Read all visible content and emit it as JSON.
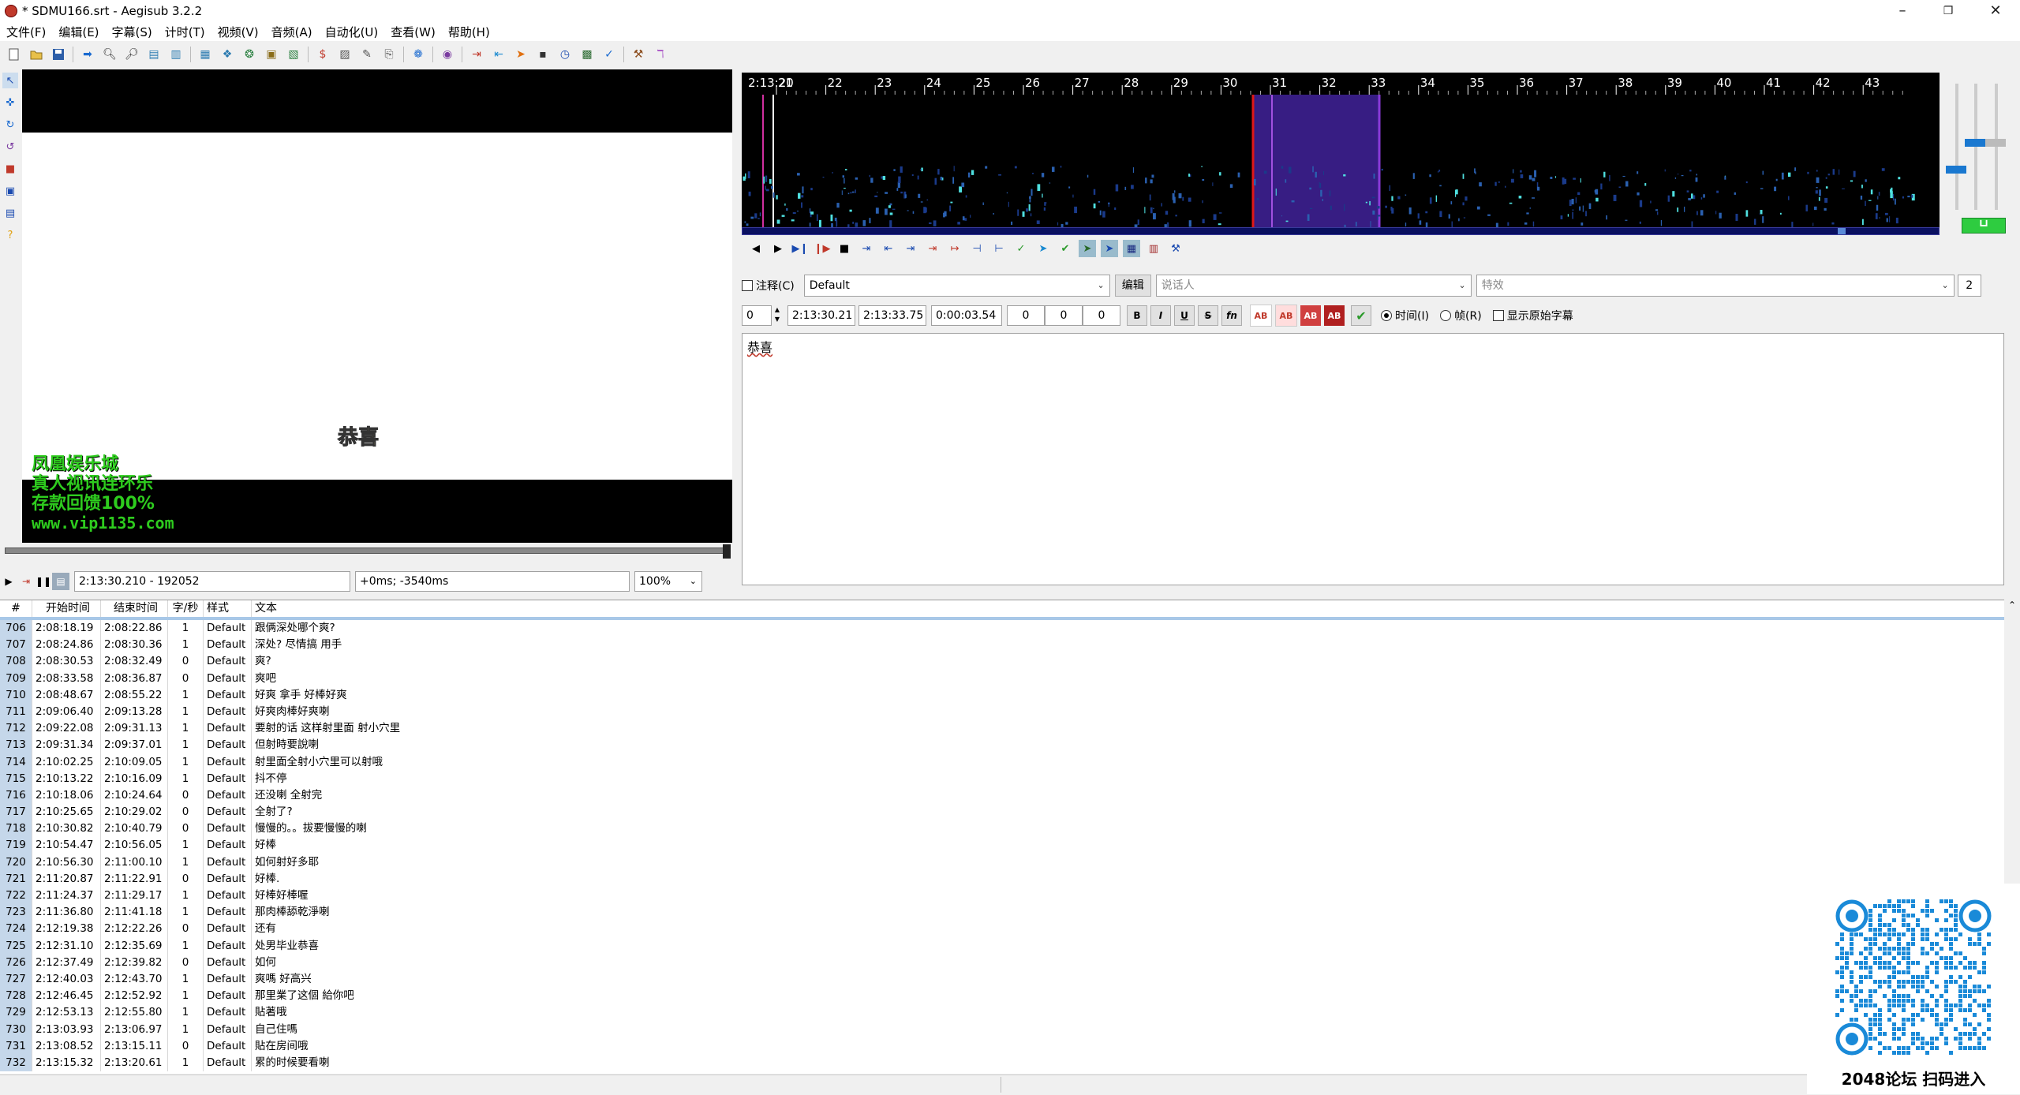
{
  "window": {
    "title": "* SDMU166.srt - Aegisub 3.2.2"
  },
  "menu": [
    "文件(F)",
    "编辑(E)",
    "字幕(S)",
    "计时(T)",
    "视频(V)",
    "音频(A)",
    "自动化(U)",
    "查看(W)",
    "帮助(H)"
  ],
  "video": {
    "ad_lines": [
      "凤凰娱乐城",
      "真人视讯连环乐",
      "存款回馈100%",
      "www.vip1135.com"
    ],
    "subtitle_center": "恭喜",
    "subtitle_right": "恭喜",
    "time_field": "2:13:30.210 - 192052",
    "offset_field": "+0ms; -3540ms",
    "zoom": "100%"
  },
  "audio": {
    "start_label": "2:13:20",
    "tick_labels": [
      "21",
      "22",
      "23",
      "24",
      "25",
      "26",
      "27",
      "28",
      "29",
      "30",
      "31",
      "32",
      "33",
      "34",
      "35",
      "36",
      "37",
      "38",
      "39",
      "40",
      "41",
      "42",
      "43"
    ],
    "selection_color": "#3a1f8a",
    "start_marker_color": "#e01818",
    "end_marker_color": "#8a3ad8"
  },
  "edit": {
    "comment_label": "注释(C)",
    "style_value": "Default",
    "edit_button": "编辑",
    "actor_placeholder": "说话人",
    "effect_placeholder": "特效",
    "char_count": "2",
    "layer": "0",
    "start_time": "2:13:30.21",
    "end_time": "2:13:33.75",
    "duration": "0:00:03.54",
    "margin_l": "0",
    "margin_r": "0",
    "margin_v": "0",
    "fmt_bold": "B",
    "fmt_italic": "I",
    "fmt_underline": "U",
    "fmt_strike": "S",
    "fmt_font": "fn",
    "color_label": "AB",
    "radio_time": "时间(I)",
    "radio_frame": "帧(R)",
    "show_original": "显示原始字幕",
    "text": "恭喜"
  },
  "grid": {
    "headers": {
      "num": "#",
      "start": "开始时间",
      "end": "结束时间",
      "cps": "字/秒",
      "style": "样式",
      "text": "文本"
    },
    "rows": [
      {
        "n": "706",
        "s": "2:08:18.19",
        "e": "2:08:22.86",
        "c": "1",
        "st": "Default",
        "t": "跟俩深处哪个爽?"
      },
      {
        "n": "707",
        "s": "2:08:24.86",
        "e": "2:08:30.36",
        "c": "1",
        "st": "Default",
        "t": "深处? 尽情搞 用手"
      },
      {
        "n": "708",
        "s": "2:08:30.53",
        "e": "2:08:32.49",
        "c": "0",
        "st": "Default",
        "t": "爽?"
      },
      {
        "n": "709",
        "s": "2:08:33.58",
        "e": "2:08:36.87",
        "c": "0",
        "st": "Default",
        "t": "爽吧"
      },
      {
        "n": "710",
        "s": "2:08:48.67",
        "e": "2:08:55.22",
        "c": "1",
        "st": "Default",
        "t": "好爽 拿手 好棒好爽"
      },
      {
        "n": "711",
        "s": "2:09:06.40",
        "e": "2:09:13.28",
        "c": "1",
        "st": "Default",
        "t": "好爽肉棒好爽喇"
      },
      {
        "n": "712",
        "s": "2:09:22.08",
        "e": "2:09:31.13",
        "c": "1",
        "st": "Default",
        "t": "要射的话 这样射里面 射小穴里"
      },
      {
        "n": "713",
        "s": "2:09:31.34",
        "e": "2:09:37.01",
        "c": "1",
        "st": "Default",
        "t": "但射時要說喇"
      },
      {
        "n": "714",
        "s": "2:10:02.25",
        "e": "2:10:09.05",
        "c": "1",
        "st": "Default",
        "t": "射里面全射小穴里可以射哦"
      },
      {
        "n": "715",
        "s": "2:10:13.22",
        "e": "2:10:16.09",
        "c": "1",
        "st": "Default",
        "t": "抖不停"
      },
      {
        "n": "716",
        "s": "2:10:18.06",
        "e": "2:10:24.64",
        "c": "0",
        "st": "Default",
        "t": "还没喇 全射完"
      },
      {
        "n": "717",
        "s": "2:10:25.65",
        "e": "2:10:29.02",
        "c": "0",
        "st": "Default",
        "t": "全射了?"
      },
      {
        "n": "718",
        "s": "2:10:30.82",
        "e": "2:10:40.79",
        "c": "0",
        "st": "Default",
        "t": "慢慢的。。拔要慢慢的喇"
      },
      {
        "n": "719",
        "s": "2:10:54.47",
        "e": "2:10:56.05",
        "c": "1",
        "st": "Default",
        "t": "好棒"
      },
      {
        "n": "720",
        "s": "2:10:56.30",
        "e": "2:11:00.10",
        "c": "1",
        "st": "Default",
        "t": "如何射好多耶"
      },
      {
        "n": "721",
        "s": "2:11:20.87",
        "e": "2:11:22.91",
        "c": "0",
        "st": "Default",
        "t": "好棒."
      },
      {
        "n": "722",
        "s": "2:11:24.37",
        "e": "2:11:29.17",
        "c": "1",
        "st": "Default",
        "t": "好棒好棒喔"
      },
      {
        "n": "723",
        "s": "2:11:36.80",
        "e": "2:11:41.18",
        "c": "1",
        "st": "Default",
        "t": "那肉棒舔乾淨喇"
      },
      {
        "n": "724",
        "s": "2:12:19.38",
        "e": "2:12:22.26",
        "c": "0",
        "st": "Default",
        "t": "还有"
      },
      {
        "n": "725",
        "s": "2:12:31.10",
        "e": "2:12:35.69",
        "c": "1",
        "st": "Default",
        "t": "处男毕业恭喜"
      },
      {
        "n": "726",
        "s": "2:12:37.49",
        "e": "2:12:39.82",
        "c": "0",
        "st": "Default",
        "t": "如何"
      },
      {
        "n": "727",
        "s": "2:12:40.03",
        "e": "2:12:43.70",
        "c": "1",
        "st": "Default",
        "t": "爽嗎 好高兴"
      },
      {
        "n": "728",
        "s": "2:12:46.45",
        "e": "2:12:52.92",
        "c": "1",
        "st": "Default",
        "t": "那里業了这個 給你吧"
      },
      {
        "n": "729",
        "s": "2:12:53.13",
        "e": "2:12:55.80",
        "c": "1",
        "st": "Default",
        "t": "貼著哦"
      },
      {
        "n": "730",
        "s": "2:13:03.93",
        "e": "2:13:06.97",
        "c": "1",
        "st": "Default",
        "t": "自己住嗎"
      },
      {
        "n": "731",
        "s": "2:13:08.52",
        "e": "2:13:15.11",
        "c": "0",
        "st": "Default",
        "t": "貼在房间哦"
      },
      {
        "n": "732",
        "s": "2:13:15.32",
        "e": "2:13:20.61",
        "c": "1",
        "st": "Default",
        "t": "累的时候要看喇"
      }
    ]
  },
  "overlay": {
    "caption": "2048论坛 扫码进入"
  }
}
